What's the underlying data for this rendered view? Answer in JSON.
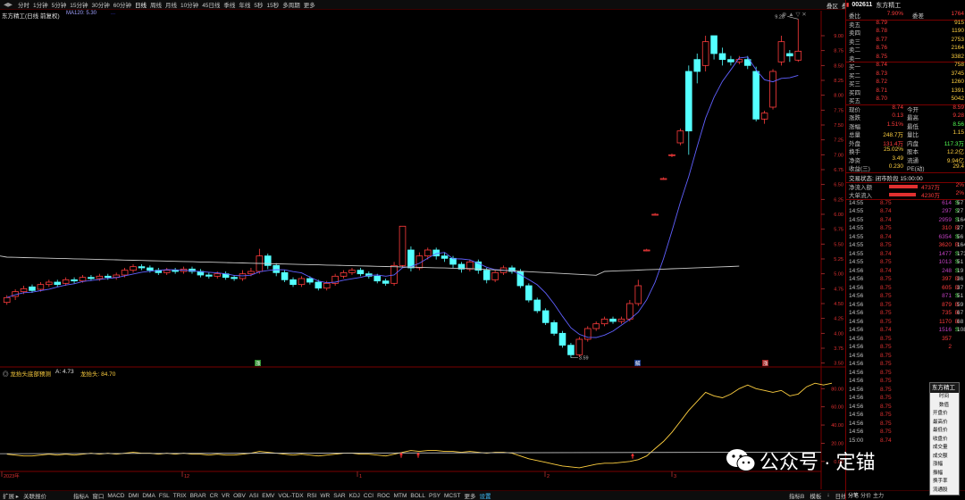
{
  "toolbar": {
    "items": [
      "分时",
      "1分钟",
      "5分钟",
      "15分钟",
      "30分钟",
      "60分钟",
      "日线",
      "周线",
      "月线",
      "10分钟",
      "45日线",
      "季线",
      "年线",
      "5秒",
      "15秒",
      "多周期",
      "更多"
    ],
    "selected": "日线",
    "right_items": [
      "叠区",
      "叠加",
      "多股",
      "统计",
      "画线",
      "F10",
      "标记",
      "+自选",
      "返回"
    ]
  },
  "chart_info": {
    "title": "东方精工(日线 前复权)",
    "ma_label": "MA120: 5.30",
    "ma_extra": "..."
  },
  "colors": {
    "up": "#ff3c3c",
    "down": "#54ffff",
    "ma": "#6060ff",
    "ma120": "#c8c8c8",
    "indicator": "#ffd040",
    "bg": "#000000",
    "grid": "#7a0000"
  },
  "price_axis": [
    "9.00",
    "8.75",
    "8.50",
    "8.25",
    "8.00",
    "7.75",
    "7.50",
    "7.25",
    "7.00",
    "6.75",
    "6.50",
    "6.25",
    "6.00",
    "5.75",
    "5.50",
    "5.25",
    "5.00",
    "4.75",
    "4.50",
    "4.25",
    "4.00",
    "3.75",
    "3.50"
  ],
  "annotations": {
    "high": "9.28",
    "low": "3.59"
  },
  "badges": [
    "涨",
    "解",
    "涨"
  ],
  "indicator": {
    "title": "龙抬头底部预测",
    "a_label": "A: 4.73",
    "b_label": "龙抬头: 84.70",
    "axis": [
      "80.00",
      "60.00",
      "40.00",
      "20.00",
      "0.00"
    ]
  },
  "x_labels": [
    "2023年",
    "12",
    "1",
    "2",
    "3"
  ],
  "bottom_tabs": [
    "指标A",
    "窗口",
    "MACD",
    "DMI",
    "DMA",
    "FSL",
    "TRIX",
    "BRAR",
    "CR",
    "VR",
    "OBV",
    "ASI",
    "EMV",
    "VOL-TDX",
    "RSI",
    "WR",
    "SAR",
    "KDJ",
    "CCI",
    "ROC",
    "MTM",
    "BOLL",
    "PSY",
    "MCST",
    "更多",
    "设置"
  ],
  "bottom_right": [
    "指标B",
    "模板",
    "↓",
    "日线"
  ],
  "footer": {
    "left": "扩展 ▸",
    "sub": "关联报价"
  },
  "quote": {
    "code": "002611",
    "name": "东方精工",
    "weibi": {
      "label": "委比",
      "value": "7.90%",
      "label2": "委差",
      "value2": "1764"
    },
    "asks": [
      {
        "label": "卖五",
        "price": "8.79",
        "vol": "915"
      },
      {
        "label": "卖四",
        "price": "8.78",
        "vol": "1190"
      },
      {
        "label": "卖三",
        "price": "8.77",
        "vol": "2753"
      },
      {
        "label": "卖二",
        "price": "8.76",
        "vol": "2164"
      },
      {
        "label": "卖一",
        "price": "8.75",
        "vol": "3382"
      }
    ],
    "bids": [
      {
        "label": "买一",
        "price": "8.74",
        "vol": "758"
      },
      {
        "label": "买二",
        "price": "8.73",
        "vol": "3745"
      },
      {
        "label": "买三",
        "price": "8.72",
        "vol": "1260"
      },
      {
        "label": "买四",
        "price": "8.71",
        "vol": "1391"
      },
      {
        "label": "买五",
        "price": "8.70",
        "vol": "5042"
      }
    ],
    "stats": [
      {
        "l1": "现价",
        "v1": "8.74",
        "l2": "今开",
        "v2": "8.59"
      },
      {
        "l1": "涨跌",
        "v1": "0.13",
        "l2": "最高",
        "v2": "9.28"
      },
      {
        "l1": "涨幅",
        "v1": "1.51%",
        "l2": "最低",
        "v2": "8.56"
      },
      {
        "l1": "总量",
        "v1": "248.7万",
        "l2": "量比",
        "v2": "1.15"
      },
      {
        "l1": "外盘",
        "v1": "131.4万",
        "l2": "内盘",
        "v2": "117.3万"
      },
      {
        "l1": "换手",
        "v1": "25.02%",
        "l2": "股本",
        "v2": "12.2亿"
      },
      {
        "l1": "净资",
        "v1": "3.49",
        "l2": "流通",
        "v2": "9.94亿"
      },
      {
        "l1": "收益(三)",
        "v1": "0.230",
        "l2": "PE(动)",
        "v2": "29.4"
      }
    ],
    "status": "交易状态: 闭市阶段 15:00:00",
    "flows": [
      {
        "label": "净流入额",
        "value": "4737万",
        "pct": "2%"
      },
      {
        "label": "大单流入",
        "value": "4230万",
        "pct": "2%"
      }
    ],
    "ticks": [
      {
        "t": "14:55",
        "p": "8.75",
        "v": "614",
        "s": "S",
        "n": "57"
      },
      {
        "t": "14:55",
        "p": "8.74",
        "v": "297",
        "s": "S",
        "n": "27"
      },
      {
        "t": "14:55",
        "p": "8.74",
        "v": "2959",
        "s": "S",
        "n": "164"
      },
      {
        "t": "14:55",
        "p": "8.75",
        "v": "310",
        "s": "B",
        "n": "27"
      },
      {
        "t": "14:55",
        "p": "8.74",
        "v": "6354",
        "s": "S",
        "n": "56"
      },
      {
        "t": "14:55",
        "p": "8.75",
        "v": "3620",
        "s": "B",
        "n": "164"
      },
      {
        "t": "14:55",
        "p": "8.74",
        "v": "1477",
        "s": "S",
        "n": "173"
      },
      {
        "t": "14:55",
        "p": "8.75",
        "v": "1013",
        "s": "S",
        "n": "51"
      },
      {
        "t": "14:56",
        "p": "8.74",
        "v": "248",
        "s": "S",
        "n": "19"
      },
      {
        "t": "14:56",
        "p": "8.75",
        "v": "397",
        "s": "B",
        "n": "36"
      },
      {
        "t": "14:56",
        "p": "8.75",
        "v": "605",
        "s": "B",
        "n": "37"
      },
      {
        "t": "14:56",
        "p": "8.75",
        "v": "871",
        "s": "S",
        "n": "51"
      },
      {
        "t": "14:56",
        "p": "8.75",
        "v": "879",
        "s": "B",
        "n": "59"
      },
      {
        "t": "14:56",
        "p": "8.75",
        "v": "735",
        "s": "B",
        "n": "67"
      },
      {
        "t": "14:56",
        "p": "8.75",
        "v": "1170",
        "s": "B",
        "n": "68"
      },
      {
        "t": "14:56",
        "p": "8.74",
        "v": "1516",
        "s": "S",
        "n": "108"
      },
      {
        "t": "14:56",
        "p": "8.75",
        "v": "357",
        "s": "",
        "n": ""
      },
      {
        "t": "14:56",
        "p": "8.75",
        "v": "2",
        "s": "",
        "n": ""
      },
      {
        "t": "14:56",
        "p": "8.75",
        "v": "",
        "s": "",
        "n": ""
      },
      {
        "t": "14:56",
        "p": "8.75",
        "v": "",
        "s": "",
        "n": ""
      },
      {
        "t": "14:56",
        "p": "8.75",
        "v": "",
        "s": "",
        "n": ""
      },
      {
        "t": "14:56",
        "p": "8.75",
        "v": "",
        "s": "",
        "n": ""
      },
      {
        "t": "14:56",
        "p": "8.75",
        "v": "",
        "s": "",
        "n": ""
      },
      {
        "t": "14:56",
        "p": "8.75",
        "v": "",
        "s": "",
        "n": ""
      },
      {
        "t": "14:56",
        "p": "8.75",
        "v": "",
        "s": "",
        "n": ""
      },
      {
        "t": "14:56",
        "p": "8.75",
        "v": "",
        "s": "",
        "n": ""
      },
      {
        "t": "14:56",
        "p": "8.75",
        "v": "",
        "s": "",
        "n": ""
      },
      {
        "t": "14:56",
        "p": "8.75",
        "v": "",
        "s": "",
        "n": ""
      },
      {
        "t": "15:00",
        "p": "8.74",
        "v": "3189",
        "s": "",
        "n": ""
      }
    ],
    "tick_tabs": [
      "分笔",
      "分价",
      "主力"
    ]
  },
  "context_menu": {
    "header": "东方精工",
    "items": [
      "时间",
      "数值",
      "开盘价",
      "最高价",
      "最低价",
      "收盘价",
      "成交量",
      "成交额",
      "涨幅",
      "振幅",
      "换手率",
      "流通股"
    ]
  },
  "watermark": {
    "text": "公众号 · 定锚"
  },
  "candles": [
    {
      "o": 4.52,
      "c": 4.6,
      "h": 4.64,
      "l": 4.48
    },
    {
      "o": 4.62,
      "c": 4.7,
      "h": 4.74,
      "l": 4.56
    },
    {
      "o": 4.7,
      "c": 4.75,
      "h": 4.8,
      "l": 4.66
    },
    {
      "o": 4.78,
      "c": 4.72,
      "h": 4.82,
      "l": 4.68
    },
    {
      "o": 4.74,
      "c": 4.82,
      "h": 4.86,
      "l": 4.7
    },
    {
      "o": 4.82,
      "c": 4.86,
      "h": 4.9,
      "l": 4.78
    },
    {
      "o": 4.86,
      "c": 4.82,
      "h": 4.9,
      "l": 4.78
    },
    {
      "o": 4.84,
      "c": 4.9,
      "h": 4.94,
      "l": 4.8
    },
    {
      "o": 4.9,
      "c": 4.88,
      "h": 4.94,
      "l": 4.84
    },
    {
      "o": 4.88,
      "c": 4.94,
      "h": 4.98,
      "l": 4.85
    },
    {
      "o": 4.94,
      "c": 4.92,
      "h": 4.98,
      "l": 4.88
    },
    {
      "o": 4.92,
      "c": 4.96,
      "h": 5.0,
      "l": 4.88
    },
    {
      "o": 4.96,
      "c": 4.94,
      "h": 5.0,
      "l": 4.9
    },
    {
      "o": 4.94,
      "c": 4.98,
      "h": 5.02,
      "l": 4.9
    },
    {
      "o": 4.98,
      "c": 5.06,
      "h": 5.1,
      "l": 4.94
    },
    {
      "o": 5.06,
      "c": 5.12,
      "h": 5.16,
      "l": 5.02
    },
    {
      "o": 5.12,
      "c": 5.1,
      "h": 5.16,
      "l": 5.06
    },
    {
      "o": 5.1,
      "c": 5.06,
      "h": 5.14,
      "l": 5.02
    },
    {
      "o": 5.06,
      "c": 5.02,
      "h": 5.1,
      "l": 4.98
    },
    {
      "o": 5.02,
      "c": 5.06,
      "h": 5.1,
      "l": 4.98
    },
    {
      "o": 5.06,
      "c": 5.04,
      "h": 5.1,
      "l": 5.0
    },
    {
      "o": 5.04,
      "c": 5.08,
      "h": 5.12,
      "l": 5.0
    },
    {
      "o": 5.08,
      "c": 5.04,
      "h": 5.12,
      "l": 5.0
    },
    {
      "o": 5.04,
      "c": 4.98,
      "h": 5.08,
      "l": 4.94
    },
    {
      "o": 4.98,
      "c": 4.96,
      "h": 5.02,
      "l": 4.92
    },
    {
      "o": 4.96,
      "c": 5.0,
      "h": 5.04,
      "l": 4.92
    },
    {
      "o": 5.0,
      "c": 4.94,
      "h": 5.04,
      "l": 4.9
    },
    {
      "o": 4.94,
      "c": 4.92,
      "h": 4.98,
      "l": 4.88
    },
    {
      "o": 4.92,
      "c": 5.0,
      "h": 5.06,
      "l": 4.88
    },
    {
      "o": 5.0,
      "c": 5.04,
      "h": 5.1,
      "l": 4.96
    },
    {
      "o": 5.04,
      "c": 5.3,
      "h": 5.42,
      "l": 5.0
    },
    {
      "o": 5.3,
      "c": 5.14,
      "h": 5.34,
      "l": 5.08
    },
    {
      "o": 5.14,
      "c": 5.02,
      "h": 5.18,
      "l": 4.96
    },
    {
      "o": 5.02,
      "c": 4.9,
      "h": 5.06,
      "l": 4.86
    },
    {
      "o": 4.9,
      "c": 4.82,
      "h": 4.94,
      "l": 4.78
    },
    {
      "o": 4.82,
      "c": 4.92,
      "h": 4.96,
      "l": 4.78
    },
    {
      "o": 4.92,
      "c": 4.86,
      "h": 4.96,
      "l": 4.82
    },
    {
      "o": 4.86,
      "c": 4.76,
      "h": 4.9,
      "l": 4.72
    },
    {
      "o": 4.76,
      "c": 4.84,
      "h": 4.88,
      "l": 4.72
    },
    {
      "o": 4.84,
      "c": 4.96,
      "h": 5.0,
      "l": 4.8
    },
    {
      "o": 4.96,
      "c": 5.02,
      "h": 5.06,
      "l": 4.92
    },
    {
      "o": 5.02,
      "c": 5.06,
      "h": 5.1,
      "l": 4.98
    },
    {
      "o": 5.06,
      "c": 5.0,
      "h": 5.1,
      "l": 4.96
    },
    {
      "o": 5.0,
      "c": 4.96,
      "h": 5.04,
      "l": 4.92
    },
    {
      "o": 4.96,
      "c": 4.88,
      "h": 5.0,
      "l": 4.84
    },
    {
      "o": 4.88,
      "c": 4.84,
      "h": 4.92,
      "l": 4.8
    },
    {
      "o": 4.84,
      "c": 5.14,
      "h": 5.2,
      "l": 4.8
    },
    {
      "o": 5.14,
      "c": 5.8,
      "h": 5.8,
      "l": 5.1
    },
    {
      "o": 5.4,
      "c": 5.1,
      "h": 5.46,
      "l": 5.04
    },
    {
      "o": 5.1,
      "c": 5.3,
      "h": 5.36,
      "l": 5.06
    },
    {
      "o": 5.3,
      "c": 5.4,
      "h": 5.44,
      "l": 5.24
    },
    {
      "o": 5.4,
      "c": 5.3,
      "h": 5.44,
      "l": 5.24
    },
    {
      "o": 5.3,
      "c": 5.26,
      "h": 5.36,
      "l": 5.2
    },
    {
      "o": 5.26,
      "c": 5.16,
      "h": 5.3,
      "l": 5.1
    },
    {
      "o": 5.16,
      "c": 5.08,
      "h": 5.2,
      "l": 5.02
    },
    {
      "o": 5.08,
      "c": 5.2,
      "h": 5.24,
      "l": 5.04
    },
    {
      "o": 5.2,
      "c": 5.06,
      "h": 5.24,
      "l": 5.0
    },
    {
      "o": 5.06,
      "c": 4.9,
      "h": 5.1,
      "l": 4.84
    },
    {
      "o": 4.9,
      "c": 5.02,
      "h": 5.06,
      "l": 4.86
    },
    {
      "o": 5.02,
      "c": 5.1,
      "h": 5.14,
      "l": 4.98
    },
    {
      "o": 5.1,
      "c": 5.04,
      "h": 5.14,
      "l": 5.0
    },
    {
      "o": 5.04,
      "c": 4.8,
      "h": 5.08,
      "l": 4.76
    },
    {
      "o": 4.8,
      "c": 4.56,
      "h": 4.84,
      "l": 4.52
    },
    {
      "o": 4.56,
      "c": 4.38,
      "h": 4.6,
      "l": 4.34
    },
    {
      "o": 4.38,
      "c": 4.18,
      "h": 4.42,
      "l": 4.14
    },
    {
      "o": 4.18,
      "c": 4.0,
      "h": 4.22,
      "l": 3.96
    },
    {
      "o": 4.0,
      "c": 3.8,
      "h": 4.04,
      "l": 3.76
    },
    {
      "o": 3.8,
      "c": 3.64,
      "h": 3.84,
      "l": 3.59
    },
    {
      "o": 3.64,
      "c": 3.9,
      "h": 3.94,
      "l": 3.6
    },
    {
      "o": 3.9,
      "c": 4.08,
      "h": 4.12,
      "l": 3.86
    },
    {
      "o": 4.08,
      "c": 4.16,
      "h": 4.2,
      "l": 4.04
    },
    {
      "o": 4.16,
      "c": 4.24,
      "h": 4.28,
      "l": 4.12
    },
    {
      "o": 4.24,
      "c": 4.2,
      "h": 4.28,
      "l": 4.16
    },
    {
      "o": 4.2,
      "c": 4.24,
      "h": 4.28,
      "l": 4.16
    },
    {
      "o": 4.24,
      "c": 4.5,
      "h": 4.56,
      "l": 4.2
    },
    {
      "o": 4.5,
      "c": 4.8,
      "h": 4.9,
      "l": 4.46
    },
    {
      "o": 5.4,
      "c": 5.4,
      "h": 5.42,
      "l": 5.38
    },
    {
      "o": 6.0,
      "c": 6.0,
      "h": 6.02,
      "l": 5.98
    },
    {
      "o": 6.6,
      "c": 6.6,
      "h": 6.62,
      "l": 6.58
    },
    {
      "o": 7.0,
      "c": 7.0,
      "h": 7.02,
      "l": 6.96
    },
    {
      "o": 7.2,
      "c": 7.4,
      "h": 7.44,
      "l": 7.16
    },
    {
      "o": 8.4,
      "c": 7.4,
      "h": 8.5,
      "l": 7.0
    },
    {
      "o": 8.6,
      "c": 8.4,
      "h": 8.7,
      "l": 8.2
    },
    {
      "o": 8.5,
      "c": 8.9,
      "h": 9.0,
      "l": 8.4
    },
    {
      "o": 9.0,
      "c": 8.7,
      "h": 9.0,
      "l": 8.6
    },
    {
      "o": 8.7,
      "c": 8.6,
      "h": 8.8,
      "l": 8.5
    },
    {
      "o": 8.6,
      "c": 8.56,
      "h": 8.66,
      "l": 8.5
    },
    {
      "o": 8.56,
      "c": 8.6,
      "h": 8.66,
      "l": 8.52
    },
    {
      "o": 8.6,
      "c": 8.5,
      "h": 8.66,
      "l": 8.44
    },
    {
      "o": 8.4,
      "c": 7.6,
      "h": 8.48,
      "l": 7.56
    },
    {
      "o": 7.6,
      "c": 7.7,
      "h": 7.74,
      "l": 7.52
    },
    {
      "o": 7.8,
      "c": 8.4,
      "h": 8.44,
      "l": 7.76
    },
    {
      "o": 8.56,
      "c": 8.9,
      "h": 9.0,
      "l": 8.5
    },
    {
      "o": 8.7,
      "c": 8.66,
      "h": 8.76,
      "l": 8.56
    },
    {
      "o": 8.59,
      "c": 8.74,
      "h": 9.28,
      "l": 8.56
    }
  ],
  "indicator_values": [
    8,
    7,
    6,
    6,
    7,
    8,
    7,
    8,
    7,
    8,
    9,
    8,
    9,
    8,
    9,
    10,
    9,
    9,
    8,
    9,
    8,
    9,
    8,
    8,
    7,
    8,
    7,
    7,
    8,
    9,
    11,
    10,
    9,
    8,
    7,
    8,
    7,
    6,
    7,
    8,
    9,
    9,
    8,
    8,
    7,
    6,
    8,
    10,
    12,
    11,
    12,
    12,
    11,
    11,
    10,
    11,
    10,
    9,
    10,
    10,
    9,
    6,
    3,
    1,
    -1,
    -3,
    -5,
    -6,
    -7,
    -5,
    -3,
    -2,
    -2,
    -1,
    0,
    2,
    6,
    14,
    22,
    32,
    44,
    56,
    66,
    76,
    72,
    70,
    74,
    80,
    84,
    80,
    78,
    76,
    78,
    72,
    74,
    82,
    86,
    84,
    86
  ]
}
